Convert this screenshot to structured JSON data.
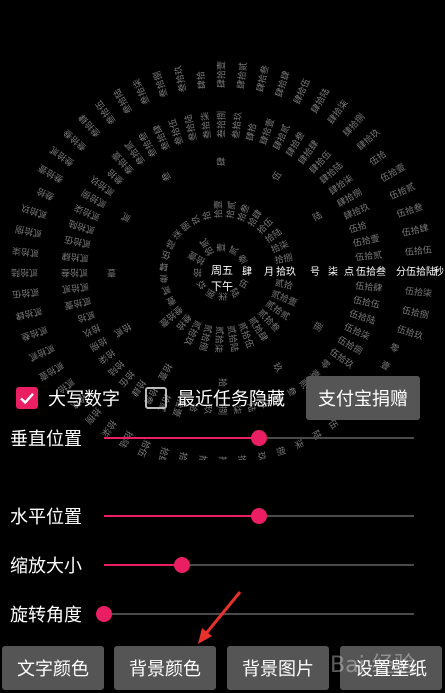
{
  "clock": {
    "center_day": "周五",
    "center_ampm": "下午",
    "month": "肆",
    "month_unit": "月",
    "day": "拾玖",
    "day_unit": "号",
    "hour": "柒",
    "hour_unit": "点",
    "minute": "伍拾叁",
    "minute_unit": "分",
    "second": "伍拾陆",
    "second_unit": "秒",
    "month_ring": [
      "伍",
      "陆",
      "柒",
      "捌",
      "玖",
      "拾",
      "拾壹",
      "拾贰",
      "壹",
      "贰",
      "叁"
    ],
    "day_ring": [
      "贰拾",
      "贰拾壹",
      "贰拾贰",
      "贰拾叁",
      "贰拾肆",
      "贰拾伍",
      "贰拾陆",
      "贰拾柒",
      "贰拾捌",
      "贰拾玖",
      "叁拾",
      "叁拾壹",
      "壹",
      "贰",
      "叁",
      "肆",
      "伍",
      "陆",
      "柒",
      "捌",
      "玖",
      "拾",
      "拾壹",
      "拾贰",
      "拾叁",
      "拾肆",
      "拾伍",
      "拾陆",
      "拾柒",
      "拾捌"
    ],
    "hour_ring": [
      "捌",
      "玖",
      "拾",
      "拾壹",
      "拾贰",
      "壹",
      "贰",
      "叁",
      "肆",
      "伍",
      "陆"
    ],
    "minute_ring": [
      "伍拾肆",
      "伍拾伍",
      "伍拾陆",
      "伍拾柒",
      "伍拾捌",
      "伍拾玖",
      "零",
      "壹",
      "贰",
      "叁",
      "肆",
      "伍",
      "陆",
      "柒",
      "捌",
      "玖",
      "拾",
      "拾壹",
      "拾贰",
      "拾叁",
      "拾肆",
      "拾伍",
      "拾陆",
      "拾柒",
      "拾捌",
      "拾玖",
      "贰拾",
      "贰拾壹",
      "贰拾贰",
      "贰拾叁",
      "贰拾肆",
      "贰拾伍",
      "贰拾陆",
      "贰拾柒",
      "贰拾捌",
      "贰拾玖",
      "叁拾",
      "叁拾壹",
      "叁拾贰",
      "叁拾叁",
      "叁拾肆",
      "叁拾伍",
      "叁拾陆",
      "叁拾柒",
      "叁拾捌",
      "叁拾玖",
      "肆拾",
      "肆拾壹",
      "肆拾贰",
      "肆拾叁",
      "肆拾肆",
      "肆拾伍",
      "肆拾陆",
      "肆拾柒",
      "肆拾捌",
      "肆拾玖",
      "伍拾",
      "伍拾壹",
      "伍拾贰"
    ],
    "second_ring": [
      "伍拾柒",
      "伍拾捌",
      "伍拾玖",
      "零",
      "壹",
      "贰",
      "叁",
      "肆",
      "伍",
      "陆",
      "柒",
      "捌",
      "玖",
      "拾",
      "拾壹",
      "拾贰",
      "拾叁",
      "拾肆",
      "拾伍",
      "拾陆",
      "拾柒",
      "拾捌",
      "拾玖",
      "贰拾",
      "贰拾壹",
      "贰拾贰",
      "贰拾叁",
      "贰拾肆",
      "贰拾伍",
      "贰拾陆",
      "贰拾柒",
      "贰拾捌",
      "贰拾玖",
      "叁拾",
      "叁拾壹",
      "叁拾贰",
      "叁拾叁",
      "叁拾肆",
      "叁拾伍",
      "叁拾陆",
      "叁拾柒",
      "叁拾捌",
      "叁拾玖",
      "肆拾",
      "肆拾壹",
      "肆拾贰",
      "肆拾叁",
      "肆拾肆",
      "肆拾伍",
      "肆拾陆",
      "肆拾柒",
      "肆拾捌",
      "肆拾玖",
      "伍拾",
      "伍拾壹",
      "伍拾贰",
      "伍拾叁",
      "伍拾肆",
      "伍拾伍"
    ],
    "text_color": "#ffffff",
    "dim_color": "#7a7a7a"
  },
  "options": {
    "uppercase_numbers": {
      "label": "大写数字",
      "checked": true
    },
    "hide_recent_tasks": {
      "label": "最近任务隐藏",
      "checked": false
    },
    "donate_label": "支付宝捐赠"
  },
  "sliders": [
    {
      "label": "垂直位置",
      "value": 0.5
    },
    {
      "label": "水平位置",
      "value": 0.5
    },
    {
      "label": "缩放大小",
      "value": 0.25
    },
    {
      "label": "旋转角度",
      "value": 0.0
    }
  ],
  "buttons": {
    "text_color": "文字颜色",
    "background_color": "背景颜色",
    "background_image": "背景图片",
    "set_wallpaper": "设置壁纸"
  },
  "watermark": "Bai 经验",
  "colors": {
    "accent": "#e91e63",
    "button_bg": "#555555",
    "background": "#000000"
  }
}
